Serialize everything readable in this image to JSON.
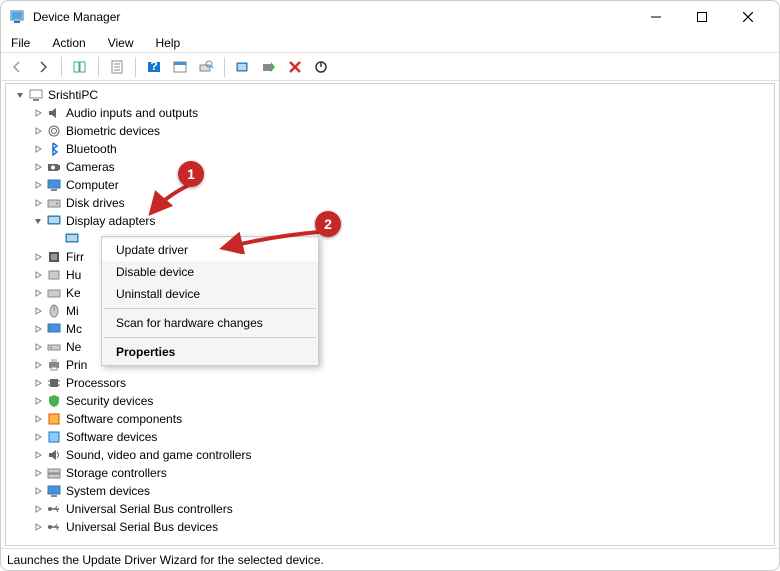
{
  "window": {
    "title": "Device Manager"
  },
  "menu": {
    "file": "File",
    "action": "Action",
    "view": "View",
    "help": "Help"
  },
  "tree": {
    "root": "SrishtiPC",
    "items": [
      {
        "label": "Audio inputs and outputs",
        "exp": false
      },
      {
        "label": "Biometric devices",
        "exp": false
      },
      {
        "label": "Bluetooth",
        "exp": false
      },
      {
        "label": "Cameras",
        "exp": false
      },
      {
        "label": "Computer",
        "exp": false
      },
      {
        "label": "Disk drives",
        "exp": false
      },
      {
        "label": "Display adapters",
        "exp": true
      },
      {
        "label": "Firr",
        "exp": false
      },
      {
        "label": "Hu",
        "exp": false
      },
      {
        "label": "Ke",
        "exp": false
      },
      {
        "label": "Mi",
        "exp": false
      },
      {
        "label": "Mc",
        "exp": false
      },
      {
        "label": "Ne",
        "exp": false
      },
      {
        "label": "Prin",
        "exp": false
      },
      {
        "label": "Processors",
        "exp": false
      },
      {
        "label": "Security devices",
        "exp": false
      },
      {
        "label": "Software components",
        "exp": false
      },
      {
        "label": "Software devices",
        "exp": false
      },
      {
        "label": "Sound, video and game controllers",
        "exp": false
      },
      {
        "label": "Storage controllers",
        "exp": false
      },
      {
        "label": "System devices",
        "exp": false
      },
      {
        "label": "Universal Serial Bus controllers",
        "exp": false
      },
      {
        "label": "Universal Serial Bus devices",
        "exp": false
      }
    ]
  },
  "context_menu": {
    "update_driver": "Update driver",
    "disable_device": "Disable device",
    "uninstall_device": "Uninstall device",
    "scan": "Scan for hardware changes",
    "properties": "Properties"
  },
  "callouts": {
    "one": "1",
    "two": "2"
  },
  "status": "Launches the Update Driver Wizard for the selected device."
}
